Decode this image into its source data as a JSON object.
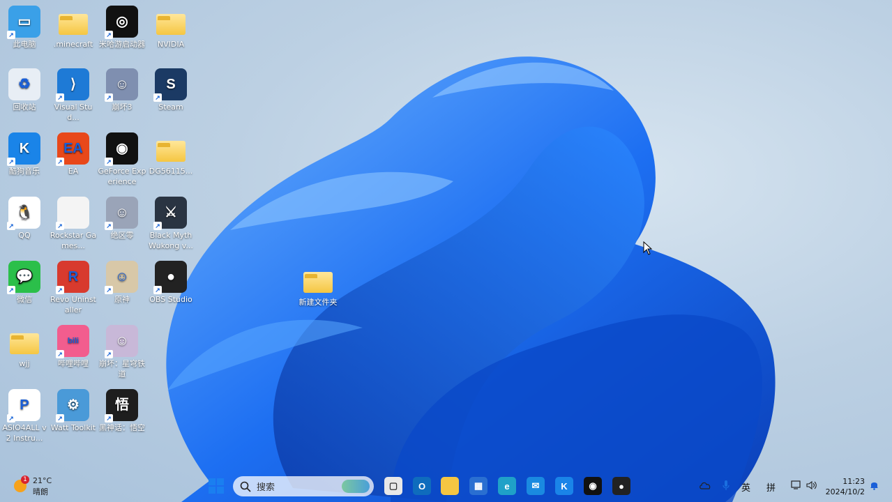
{
  "desktop_icons": [
    {
      "label": "此电脑",
      "color": "#3aa0e8",
      "glyph": "▭",
      "shortcut": true
    },
    {
      "label": ".minecraft",
      "color": "folder",
      "glyph": "",
      "shortcut": false
    },
    {
      "label": "米哈游启动器",
      "color": "#111111",
      "glyph": "◎",
      "shortcut": true
    },
    {
      "label": "NVIDIA",
      "color": "folder",
      "glyph": "",
      "shortcut": false
    },
    {
      "label": "回收站",
      "color": "#e8eef5",
      "glyph": "♻",
      "shortcut": false
    },
    {
      "label": "Visual Stud...",
      "color": "#1e7ad6",
      "glyph": "⟩",
      "shortcut": true
    },
    {
      "label": "崩坏3",
      "color": "#7f8fb0",
      "glyph": "☺",
      "shortcut": true
    },
    {
      "label": "Steam",
      "color": "#1b3a64",
      "glyph": "S",
      "shortcut": true
    },
    {
      "label": "酷狗音乐",
      "color": "#1a84e8",
      "glyph": "K",
      "shortcut": true
    },
    {
      "label": "EA",
      "color": "#e8481a",
      "glyph": "EA",
      "shortcut": true
    },
    {
      "label": "GeForce Experience",
      "color": "#111111",
      "glyph": "◉",
      "shortcut": true
    },
    {
      "label": "DG56115...",
      "color": "folder",
      "glyph": "",
      "shortcut": false
    },
    {
      "label": "QQ",
      "color": "#ffffff",
      "glyph": "🐧",
      "shortcut": true
    },
    {
      "label": "Rockstar Games...",
      "color": "#f4f4f4",
      "glyph": "",
      "shortcut": true
    },
    {
      "label": "绝区零",
      "color": "#9aa4b8",
      "glyph": "☺",
      "shortcut": true
    },
    {
      "label": "Black Myth Wukong v...",
      "color": "#2a3442",
      "glyph": "⚔",
      "shortcut": true
    },
    {
      "label": "微信",
      "color": "#2bbf4a",
      "glyph": "💬",
      "shortcut": true
    },
    {
      "label": "Revo Uninstaller",
      "color": "#d83a2e",
      "glyph": "R",
      "shortcut": true
    },
    {
      "label": "原神",
      "color": "#d8c8a8",
      "glyph": "☺",
      "shortcut": true
    },
    {
      "label": "OBS Studio",
      "color": "#222222",
      "glyph": "●",
      "shortcut": true
    },
    {
      "label": "wjj",
      "color": "folder",
      "glyph": "",
      "shortcut": false
    },
    {
      "label": "哔哩哔哩",
      "color": "#f25d8e",
      "glyph": "bili",
      "shortcut": true
    },
    {
      "label": "崩坏：星穹铁道",
      "color": "#c8b8d8",
      "glyph": "☺",
      "shortcut": true
    },
    {
      "label": "",
      "color": "none",
      "glyph": "",
      "shortcut": false
    },
    {
      "label": "ASIO4ALL v2 Instru...",
      "color": "#ffffff",
      "glyph": "P",
      "shortcut": true
    },
    {
      "label": "Watt Toolkit",
      "color": "#4a9ad8",
      "glyph": "⚙",
      "shortcut": true
    },
    {
      "label": "黑神话：悟空",
      "color": "#1e1e1e",
      "glyph": "悟",
      "shortcut": true
    }
  ],
  "center_folder": {
    "label": "新建文件夹"
  },
  "weather": {
    "temp": "21°C",
    "condition": "晴朗",
    "badge": "1"
  },
  "search": {
    "placeholder": "搜索"
  },
  "taskbar_apps": [
    {
      "name": "task-view-icon",
      "color": "#e8e8e8",
      "glyph": "▢"
    },
    {
      "name": "outlook-icon",
      "color": "#0f6cbd",
      "glyph": "O"
    },
    {
      "name": "file-explorer-icon",
      "color": "#f5c642",
      "glyph": ""
    },
    {
      "name": "microsoft-store-icon",
      "color": "#2a6fd1",
      "glyph": "▦"
    },
    {
      "name": "edge-icon",
      "color": "#1fa1c8",
      "glyph": "e"
    },
    {
      "name": "mail-icon",
      "color": "#1a8ae0",
      "glyph": "✉"
    },
    {
      "name": "kugou-icon",
      "color": "#1a84e8",
      "glyph": "K"
    },
    {
      "name": "nvidia-icon",
      "color": "#111111",
      "glyph": "◉"
    },
    {
      "name": "obs-icon",
      "color": "#222222",
      "glyph": "●"
    }
  ],
  "tray": {
    "ime_lang": "英",
    "ime_mode": "拼",
    "time": "11:23",
    "date": "2024/10/2"
  }
}
